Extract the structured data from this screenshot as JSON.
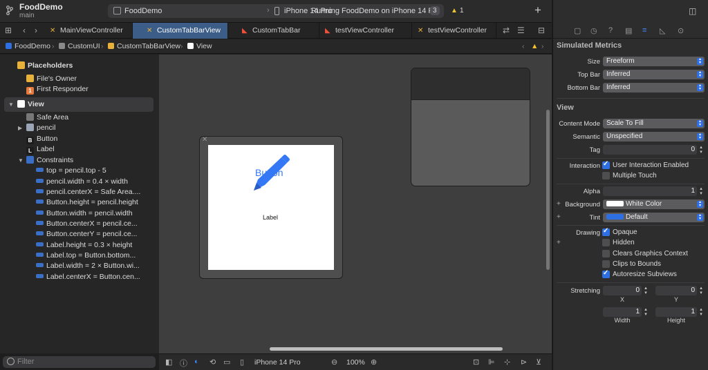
{
  "toolbar": {
    "project": "FoodDemo",
    "branch": "main",
    "scheme": "FoodDemo",
    "device": "iPhone 14 Pro",
    "status": "Running FoodDemo on iPhone 14 Pro",
    "status_count": "3",
    "warning_count": "1"
  },
  "tabs": [
    {
      "label": "MainViewController",
      "kind": "xib"
    },
    {
      "label": "CustomTabBarView",
      "kind": "xib",
      "active": true
    },
    {
      "label": "CustomTabBar",
      "kind": "swift"
    },
    {
      "label": "testViewController",
      "kind": "swift"
    },
    {
      "label": "testViewController",
      "kind": "xib"
    }
  ],
  "jumpbar": [
    "FoodDemo",
    "CustomUI",
    "CustomTabBarView",
    "View"
  ],
  "outline": {
    "placeholders": "Placeholders",
    "files_owner": "File's Owner",
    "first_responder": "First Responder",
    "view": "View",
    "safe_area": "Safe Area",
    "pencil": "pencil",
    "button": "Button",
    "label": "Label",
    "constraints": "Constraints",
    "constraint_items": [
      "top = pencil.top - 5",
      "pencil.width = 0.4 × width",
      "pencil.centerX = Safe Area....",
      "Button.height = pencil.height",
      "Button.width = pencil.width",
      "Button.centerX = pencil.ce...",
      "Button.centerY = pencil.ce...",
      "Label.height = 0.3 × height",
      "Label.top = Button.bottom...",
      "Label.width = 2 × Button.wi...",
      "Label.centerX = Button.cen..."
    ],
    "filter_placeholder": "Filter"
  },
  "canvas": {
    "button_text": "Button",
    "label_text": "Label"
  },
  "bottombar": {
    "device": "iPhone 14 Pro",
    "zoom": "100%"
  },
  "inspector": {
    "simulated_metrics": "Simulated Metrics",
    "size_label": "Size",
    "size_value": "Freeform",
    "topbar_label": "Top Bar",
    "topbar_value": "Inferred",
    "bottombar_label": "Bottom Bar",
    "bottombar_value": "Inferred",
    "view_section": "View",
    "content_mode_label": "Content Mode",
    "content_mode_value": "Scale To Fill",
    "semantic_label": "Semantic",
    "semantic_value": "Unspecified",
    "tag_label": "Tag",
    "tag_value": "0",
    "interaction_label": "Interaction",
    "user_interaction": "User Interaction Enabled",
    "multiple_touch": "Multiple Touch",
    "alpha_label": "Alpha",
    "alpha_value": "1",
    "background_label": "Background",
    "background_value": "White Color",
    "tint_label": "Tint",
    "tint_value": "Default",
    "drawing_label": "Drawing",
    "opaque": "Opaque",
    "hidden": "Hidden",
    "clears_graphics": "Clears Graphics Context",
    "clips_bounds": "Clips to Bounds",
    "autoresize": "Autoresize Subviews",
    "stretching_label": "Stretching",
    "stretch_x_value": "0",
    "stretch_y_value": "0",
    "stretch_x_label": "X",
    "stretch_y_label": "Y",
    "stretch_w_value": "1",
    "stretch_h_value": "1",
    "stretch_w_label": "Width",
    "stretch_h_label": "Height"
  },
  "colors": {
    "accent": "#2f6fe4",
    "button_blue": "#3478f6",
    "tab_active": "#3c5d87",
    "warning": "#f0c52f"
  }
}
